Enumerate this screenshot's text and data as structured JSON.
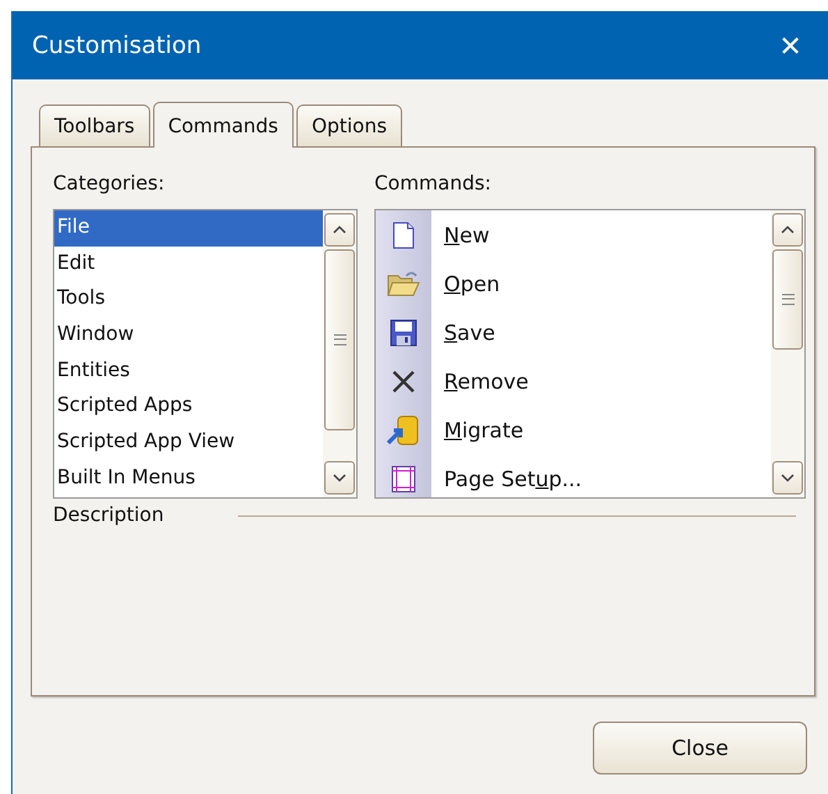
{
  "window": {
    "title": "Customisation",
    "close": "✕"
  },
  "tabs": [
    {
      "label": "Toolbars",
      "selected": false
    },
    {
      "label": "Commands",
      "selected": true
    },
    {
      "label": "Options",
      "selected": false
    }
  ],
  "categories": {
    "label": "Categories:",
    "items": [
      {
        "label": "File",
        "selected": true
      },
      {
        "label": "Edit",
        "selected": false
      },
      {
        "label": "Tools",
        "selected": false
      },
      {
        "label": "Window",
        "selected": false
      },
      {
        "label": "Entities",
        "selected": false
      },
      {
        "label": "Scripted Apps",
        "selected": false
      },
      {
        "label": "Scripted App View",
        "selected": false
      },
      {
        "label": "Built In Menus",
        "selected": false
      }
    ]
  },
  "commands": {
    "label": "Commands:",
    "items": [
      {
        "kind": "new",
        "key": "N",
        "post": "ew"
      },
      {
        "kind": "open",
        "key": "O",
        "post": "pen"
      },
      {
        "kind": "save",
        "key": "S",
        "post": "ave"
      },
      {
        "kind": "remove",
        "key": "R",
        "post": "emove"
      },
      {
        "kind": "migrate",
        "key": "M",
        "post": "igrate"
      },
      {
        "kind": "page-setup",
        "pre": "Page Set",
        "key": "u",
        "post": "p..."
      }
    ]
  },
  "description": {
    "label": "Description"
  },
  "buttons": [
    {
      "label": "Close"
    }
  ]
}
